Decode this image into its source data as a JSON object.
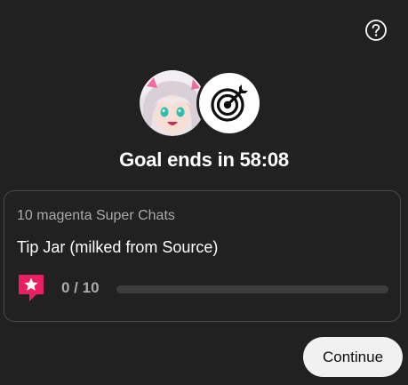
{
  "dialog": {
    "help_icon": "help-circle-icon",
    "avatar_icon": "channel-avatar",
    "goal_icon": "target-arrow-icon",
    "timer_text": "Goal ends in 58:08",
    "goal": {
      "subtitle": "10 magenta Super Chats",
      "title": "Tip Jar (milked from Source)",
      "icon": "super-chat-star-icon",
      "progress_text": "0 / 10",
      "current": 0,
      "target": 10,
      "progress_fraction": 0.0
    },
    "continue_label": "Continue"
  },
  "colors": {
    "background": "#212121",
    "card_border": "#4a4a4a",
    "accent_magenta": "#e91e63",
    "muted_text": "#aaaaaa",
    "track": "#3d3d3d",
    "button_bg": "#f1f1f1"
  }
}
